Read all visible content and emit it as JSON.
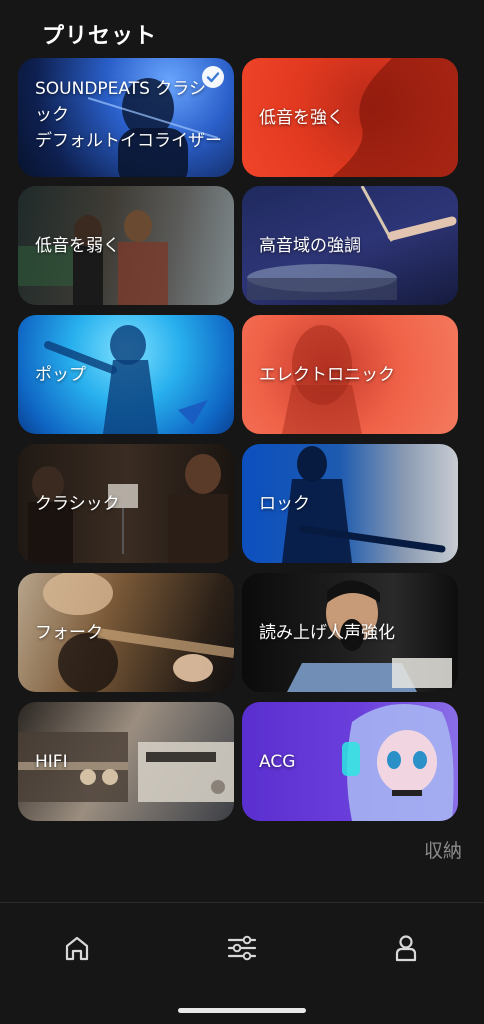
{
  "header": {
    "title": "プリセット"
  },
  "presets": [
    {
      "lines": [
        "SOUNDPEATS クラシ",
        "ック",
        "デフォルトイコライザー"
      ],
      "selected": true
    },
    {
      "lines": [
        "低音を強く"
      ],
      "selected": false
    },
    {
      "lines": [
        "低音を弱く"
      ],
      "selected": false
    },
    {
      "lines": [
        "高音域の強調"
      ],
      "selected": false
    },
    {
      "lines": [
        "ポップ"
      ],
      "selected": false
    },
    {
      "lines": [
        "エレクトロニック"
      ],
      "selected": false
    },
    {
      "lines": [
        "クラシック"
      ],
      "selected": false
    },
    {
      "lines": [
        "ロック"
      ],
      "selected": false
    },
    {
      "lines": [
        "フォーク"
      ],
      "selected": false
    },
    {
      "lines": [
        "読み上げ人声強化"
      ],
      "selected": false
    },
    {
      "lines": [
        "HIFI"
      ],
      "selected": false
    },
    {
      "lines": [
        "ACG"
      ],
      "selected": false
    }
  ],
  "collapse_label": "収納",
  "nav": {
    "items": [
      {
        "icon": "home-icon"
      },
      {
        "icon": "equalizer-icon"
      },
      {
        "icon": "profile-icon"
      }
    ]
  },
  "colors": {
    "background": "#161616",
    "check": "#3a7bd5",
    "muted": "#8a8a8a"
  }
}
